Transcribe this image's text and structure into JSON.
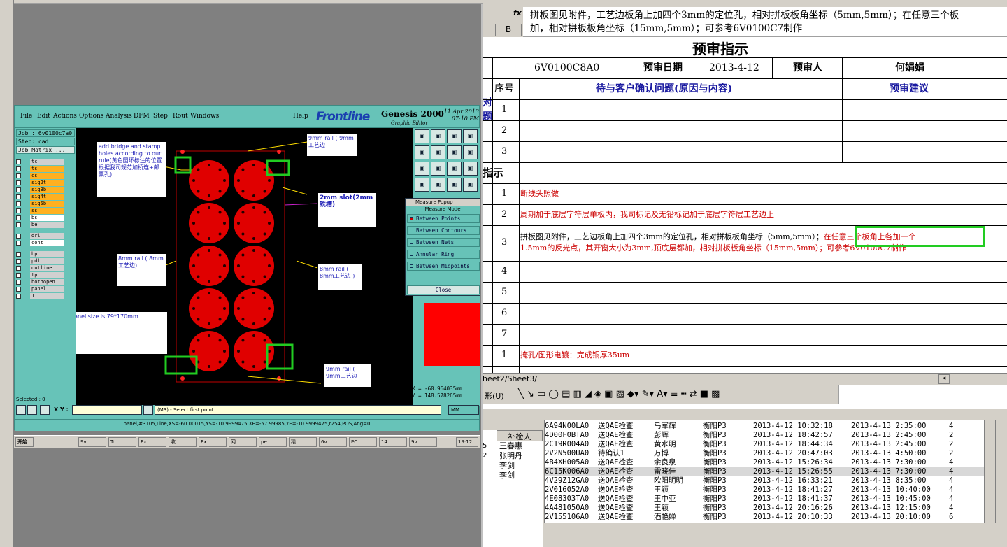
{
  "genesis": {
    "menu": [
      "File",
      "Edit",
      "Actions",
      "Options",
      "Analysis",
      "DFM",
      "Step",
      "Rout",
      "Windows"
    ],
    "help": "Help",
    "logo": "Frontline",
    "product": "Genesis 2000",
    "product_sub": "Graphic Editor",
    "date": "11 Apr 2013",
    "time": "07:10 PM",
    "job": "Job : 6v0100c7a0",
    "step": "Step: cad",
    "job_matrix": "Job Matrix ...",
    "layers": [
      "tc",
      "ts",
      "cs",
      "sig2t",
      "sig3b",
      "sig4t",
      "sig5b",
      "ss",
      "bs",
      "be",
      "drl",
      "cont",
      "bp",
      "pdl",
      "outline",
      "tp",
      "bothopen",
      "panel",
      "1"
    ],
    "notes": {
      "bridge": "add bridge and stamp holes according to our rule(黄色圆环标注的位置根据我司规范加桥连+邮票孔)",
      "rail_top": "9mm rail ( 9mm工艺边",
      "slot": "2mm slot(2mm铣槽)",
      "rail_left": "8mm rail ( 8mm工艺边)",
      "rail_right": "8mm rail ( 8mm工艺边 )",
      "panel_size": "panel size is 79*170mm",
      "rail_bottom": "9mm rail ( 9mm工艺边"
    },
    "measure": {
      "title": "Measure Popup",
      "mode": "Measure Mode",
      "options": [
        "Between Points",
        "Between Contours",
        "Between Nets",
        "Annular Ring",
        "Between Midpoints"
      ],
      "close": "Close"
    },
    "selected": "Selected : 0",
    "xy_label": "X Y :",
    "xy_value": "",
    "prompt": "(M3) - Select first point",
    "units": "MM",
    "coord_x": "X = -60.964035mm",
    "coord_y": "Y = 148.578265mm",
    "status_line": "panel,#3105,Line,XS=-60.00015,YS=-10.9999475,XE=-57.99985,YE=-10.9999475,r254,POS,Ang=0"
  },
  "taskbar": {
    "start": "开始",
    "tasks": [
      "9v...",
      "To...",
      "Ex...",
      "收...",
      "Ex...",
      "网...",
      "pe...",
      "猿...",
      "6v...",
      "PC...",
      "14...",
      "9v..."
    ],
    "clock": "19:12"
  },
  "excel": {
    "fx": "fx",
    "col": "B",
    "formula": "拼板图见附件，工艺边板角上加四个3mm的定位孔，相对拼板板角坐标（5mm,5mm）；在任意三个板角上各加一个1.5mm的反光点，其开窗大小为3mm,顶底层都加，相对拼板板角坐标（15mm,5mm）；可参考6V0100C7制作",
    "formula_line1": "拼板图见附件，工艺边板角上加四个3mm的定位孔，相对拼板板角坐标（5mm,5mm）；在任意三个板",
    "formula_line2": "加，相对拼板板角坐标（15mm,5mm）；可参考6V0100C7制作",
    "title": "预审指示",
    "part_no": "6V0100C8A0",
    "date_label": "预审日期",
    "date": "2013-4-12",
    "reviewer_label": "预审人",
    "reviewer": "何娟娟",
    "seq_label": "序号",
    "issue_label": "待与客户确认问题(原因与内容)",
    "suggest_label": "预审建议",
    "side1": "对",
    "side2": "题",
    "section": "指示",
    "rows": [
      {
        "n": "1",
        "t": ""
      },
      {
        "n": "2",
        "t": ""
      },
      {
        "n": "3",
        "t": ""
      }
    ],
    "instr": [
      {
        "n": "1",
        "t": "断线头照做"
      },
      {
        "n": "2",
        "t": "周期加于底层字符层单板内，我司标记及无铅标记加于底层字符层工艺边上"
      },
      {
        "n": "3",
        "t1": "拼板图见附件，工艺边板角上加四个3mm的定位孔，相对拼板板角坐标（5mm,5mm）；",
        "t2": "在任意三个板角上各加一个",
        "t3": "1.5mm的反光点，其开窗大小为3mm,顶底层都加，相对拼板板角坐标（15mm,5mm）；可参考6V0100C7制作"
      },
      {
        "n": "4",
        "t": ""
      },
      {
        "n": "5",
        "t": ""
      },
      {
        "n": "6",
        "t": ""
      },
      {
        "n": "7",
        "t": ""
      },
      {
        "n": "1",
        "t": "掩孔/图形电镀：完成铜厚35um"
      }
    ],
    "sheet_tabs": "heet2/Sheet3/",
    "draw_label": "形(U)"
  },
  "list": {
    "left_header": "补检人",
    "left_items": [
      "王春惠",
      "张明丹",
      "李剑",
      "李剑"
    ],
    "left_nums": [
      "5",
      "2"
    ],
    "rows": [
      [
        "6A94N00LA0",
        "送QAE检查",
        "马军辉",
        "衡阳P3",
        "2013-4-12 10:32:18",
        "2013-4-13 2:35:00",
        "4"
      ],
      [
        "4D00F0BTA0",
        "送QAE检查",
        "彭辉",
        "衡阳P3",
        "2013-4-12 18:42:57",
        "2013-4-13 2:45:00",
        "2"
      ],
      [
        "2C19R004A0",
        "送QAE检查",
        "黄水明",
        "衡阳P3",
        "2013-4-12 18:44:34",
        "2013-4-13 2:45:00",
        "2"
      ],
      [
        "2V2N500UA0",
        "待确认1",
        "万博",
        "衡阳P3",
        "2013-4-12 20:47:03",
        "2013-4-13 4:50:00",
        "2"
      ],
      [
        "4B4XH005A0",
        "送QAE检查",
        "余良泉",
        "衡阳P3",
        "2013-4-12 15:26:34",
        "2013-4-13 7:30:00",
        "4"
      ],
      [
        "6C15K006A0",
        "送QAE检查",
        "雷晓佳",
        "衡阳P3",
        "2013-4-12 15:26:55",
        "2013-4-13 7:30:00",
        "4"
      ],
      [
        "4V29Z12GA0",
        "送QAE检查",
        "欧阳明明",
        "衡阳P3",
        "2013-4-12 16:33:21",
        "2013-4-13 8:35:00",
        "4"
      ],
      [
        "2V016052A0",
        "送QAE检查",
        "王颖",
        "衡阳P3",
        "2013-4-12 18:41:27",
        "2013-4-13 10:40:00",
        "4"
      ],
      [
        "4E08303TA0",
        "送QAE检查",
        "王中亚",
        "衡阳P3",
        "2013-4-12 18:41:37",
        "2013-4-13 10:45:00",
        "4"
      ],
      [
        "4A481050A0",
        "送QAE检查",
        "王颖",
        "衡阳P3",
        "2013-4-12 20:16:26",
        "2013-4-13 12:15:00",
        "4"
      ],
      [
        "2V155106A0",
        "送QAE检查",
        "酒艳婵",
        "衡阳P3",
        "2013-4-12 20:10:33",
        "2013-4-13 20:10:00",
        "6"
      ]
    ]
  },
  "colors": {
    "genesis_bg": "#67c3b8",
    "highlight": "#22cc22",
    "excel_red": "#cc0000",
    "excel_blue": "#1a1aa0"
  }
}
